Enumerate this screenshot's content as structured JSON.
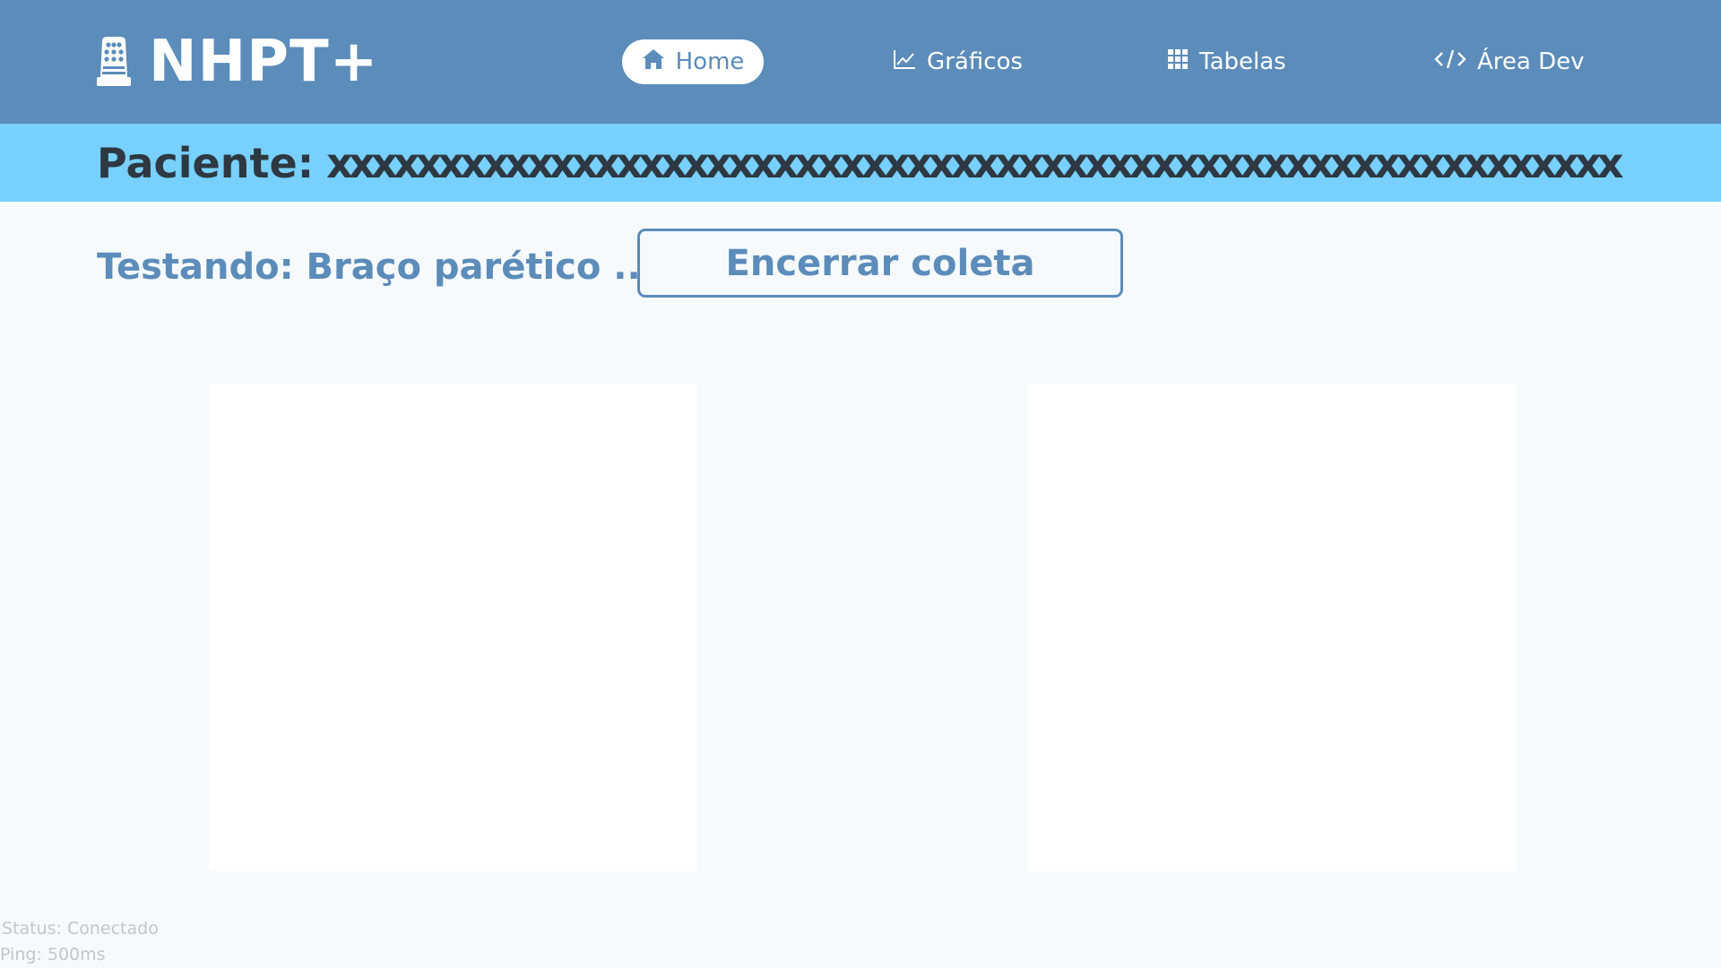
{
  "header": {
    "app_name": "NHPT+",
    "logo_icon": "thimble-pegboard-icon",
    "nav": [
      {
        "label": "Home",
        "icon": "home-icon",
        "active": true
      },
      {
        "label": "Gráficos",
        "icon": "chart-line-icon",
        "active": false
      },
      {
        "label": "Tabelas",
        "icon": "grid-table-icon",
        "active": false
      },
      {
        "label": "Área Dev",
        "icon": "code-icon",
        "active": false
      }
    ]
  },
  "patient": {
    "label": "Paciente:",
    "value": "xxxxxxxxxxxxxxxxxxxxxxxxxxxxxxxxxxxxxxxxxxxxxxxxxxxxxxxxxx"
  },
  "session": {
    "testing_text": "Testando: Braço parético ...",
    "end_button_label": "Encerrar coleta"
  },
  "footer": {
    "status": "Status: Conectado",
    "ping": "Ping: 500ms"
  },
  "colors": {
    "header_bg": "#5b8cba",
    "patient_bar_bg": "#77d0fe",
    "page_bg": "#f6fafd",
    "accent": "#5b8cba",
    "text_dark": "#2e3842",
    "status_text": "#c2c6ca"
  }
}
